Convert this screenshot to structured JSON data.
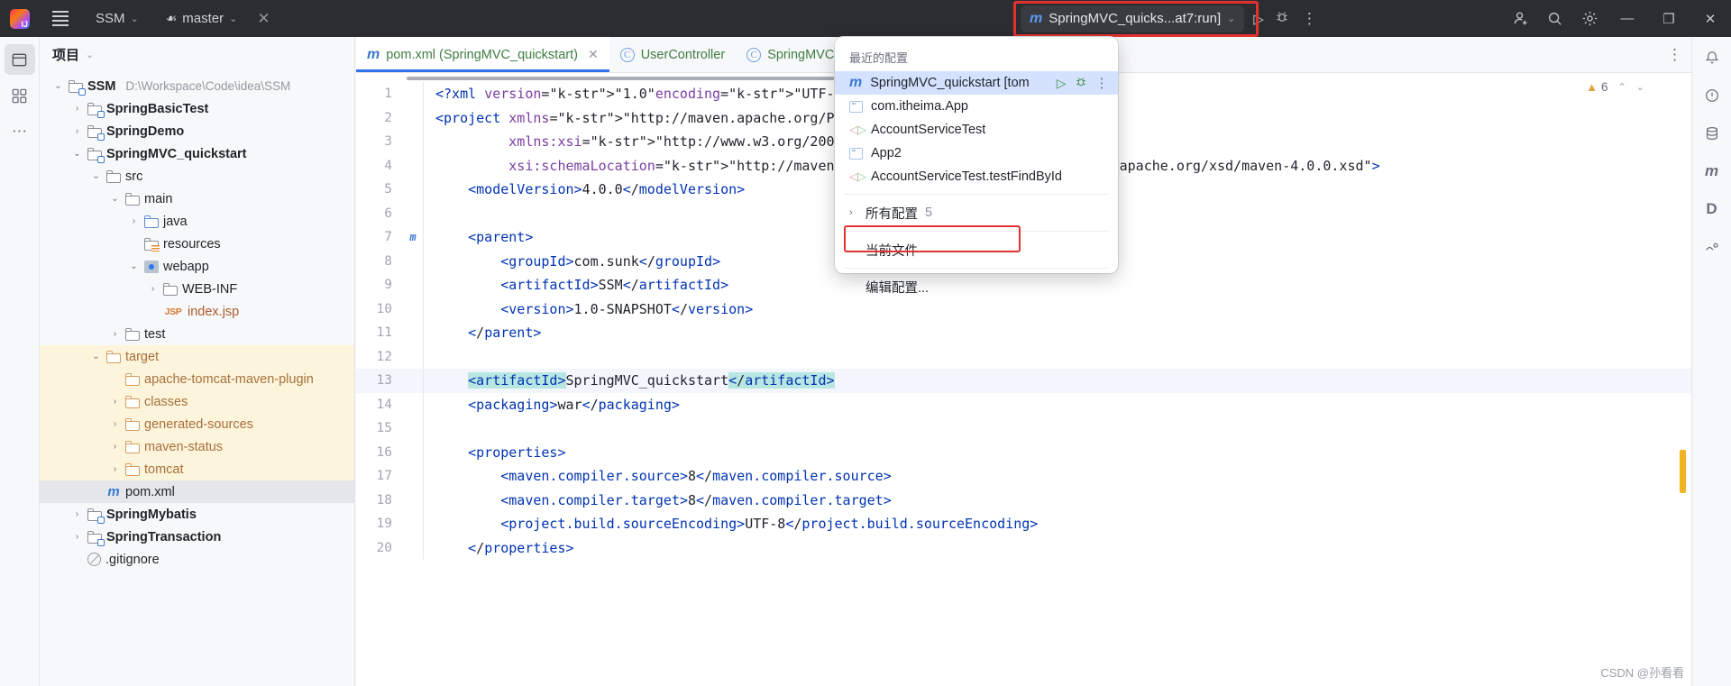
{
  "titlebar": {
    "app_logo": "intellij-idea-logo",
    "project_name": "SSM",
    "branch_icon": "git-branch-icon",
    "branch_name": "master",
    "close_label": "✕",
    "chevron": "⌄",
    "run_config": {
      "icon": "maven-m-icon",
      "label": "SpringMVC_quicks...at7:run]",
      "chevron": "⌄"
    },
    "run_button": "▷",
    "debug_button": "debug-icon",
    "more_button": "⋮",
    "account_button": "add-account-icon",
    "search_button": "search-icon",
    "settings_button": "settings-gear-icon",
    "minimize": "—",
    "maximize": "❐",
    "close_window": "✕"
  },
  "left_rail": {
    "items": [
      {
        "name": "project-tool-window",
        "glyph": "▢",
        "active": true
      },
      {
        "name": "structure-tool-window",
        "glyph": "⊞",
        "active": false
      },
      {
        "name": "more-tool-windows",
        "glyph": "⋯",
        "active": false
      }
    ]
  },
  "right_rail": {
    "items": [
      {
        "name": "notifications-icon",
        "glyph": "⚑"
      },
      {
        "name": "problems-icon",
        "glyph": "ⓘ"
      },
      {
        "name": "database-icon",
        "glyph": "⛁"
      },
      {
        "name": "maven-icon",
        "glyph": "m"
      },
      {
        "name": "dependencies-icon",
        "glyph": "D"
      },
      {
        "name": "learn-icon",
        "glyph": "◔"
      }
    ]
  },
  "project_panel": {
    "title": "项目",
    "chevron": "⌄",
    "tree": [
      {
        "indent": 0,
        "arrow": "⌄",
        "icon": "module-folder",
        "label": "SSM",
        "bold": true,
        "path": "D:\\Workspace\\Code\\idea\\SSM",
        "state": "normal"
      },
      {
        "indent": 1,
        "arrow": "›",
        "icon": "module-folder",
        "label": "SpringBasicTest",
        "bold": true,
        "state": "normal"
      },
      {
        "indent": 1,
        "arrow": "›",
        "icon": "module-folder",
        "label": "SpringDemo",
        "bold": true,
        "state": "normal"
      },
      {
        "indent": 1,
        "arrow": "⌄",
        "icon": "module-folder",
        "label": "SpringMVC_quickstart",
        "bold": true,
        "state": "normal"
      },
      {
        "indent": 2,
        "arrow": "⌄",
        "icon": "folder",
        "label": "src",
        "state": "normal"
      },
      {
        "indent": 3,
        "arrow": "⌄",
        "icon": "folder",
        "label": "main",
        "state": "normal"
      },
      {
        "indent": 4,
        "arrow": "›",
        "icon": "source-folder",
        "label": "java",
        "state": "normal"
      },
      {
        "indent": 4,
        "arrow": "",
        "icon": "resources-folder",
        "label": "resources",
        "state": "normal"
      },
      {
        "indent": 4,
        "arrow": "⌄",
        "icon": "webapp-folder",
        "label": "webapp",
        "state": "normal"
      },
      {
        "indent": 5,
        "arrow": "›",
        "icon": "folder",
        "label": "WEB-INF",
        "state": "normal"
      },
      {
        "indent": 5,
        "arrow": "",
        "icon": "jsp-file",
        "label": "index.jsp",
        "state": "normal"
      },
      {
        "indent": 3,
        "arrow": "›",
        "icon": "folder",
        "label": "test",
        "state": "normal"
      },
      {
        "indent": 2,
        "arrow": "⌄",
        "icon": "target-folder",
        "label": "target",
        "state": "target"
      },
      {
        "indent": 3,
        "arrow": "",
        "icon": "target-folder",
        "label": "apache-tomcat-maven-plugin",
        "state": "target"
      },
      {
        "indent": 3,
        "arrow": "›",
        "icon": "target-folder",
        "label": "classes",
        "state": "target"
      },
      {
        "indent": 3,
        "arrow": "›",
        "icon": "target-folder",
        "label": "generated-sources",
        "state": "target"
      },
      {
        "indent": 3,
        "arrow": "›",
        "icon": "target-folder",
        "label": "maven-status",
        "state": "target"
      },
      {
        "indent": 3,
        "arrow": "›",
        "icon": "target-folder",
        "label": "tomcat",
        "state": "target"
      },
      {
        "indent": 2,
        "arrow": "",
        "icon": "maven-file",
        "label": "pom.xml",
        "state": "selected"
      },
      {
        "indent": 1,
        "arrow": "›",
        "icon": "module-folder",
        "label": "SpringMybatis",
        "bold": true,
        "state": "normal"
      },
      {
        "indent": 1,
        "arrow": "›",
        "icon": "module-folder",
        "label": "SpringTransaction",
        "bold": true,
        "state": "normal"
      },
      {
        "indent": 1,
        "arrow": "",
        "icon": "gitignore-file",
        "label": ".gitignore",
        "state": "normal"
      }
    ]
  },
  "editor": {
    "tabs": [
      {
        "icon": "maven-m-icon",
        "label": "pom.xml (SpringMVC_quickstart)",
        "active": true,
        "closable": true,
        "close": "✕"
      },
      {
        "icon": "class-c-icon",
        "label": "UserController",
        "active": false
      },
      {
        "icon": "class-c-icon",
        "label": "SpringMVCConfig",
        "active": false
      }
    ],
    "tab_options": "⋮",
    "warnings": {
      "icon": "warning-triangle-icon",
      "count": "6",
      "up": "⌃",
      "down": "⌄"
    },
    "lines": [
      {
        "num": "1",
        "gutter": "",
        "text": "<?xml version=\"1.0\" encoding=\"UTF-8\"?>"
      },
      {
        "num": "2",
        "gutter": "",
        "text": "<project xmlns=\"http://maven.apache.org/POM/4.0.0\""
      },
      {
        "num": "3",
        "gutter": "",
        "text": "         xmlns:xsi=\"http://www.w3.org/2001/XMLSchema-instance\""
      },
      {
        "num": "4",
        "gutter": "",
        "text": "         xsi:schemaLocation=\"http://maven.apache.org/POM/4.0.0 http://maven.apache.org/xsd/maven-4.0.0.xsd\">"
      },
      {
        "num": "5",
        "gutter": "",
        "text": "    <modelVersion>4.0.0</modelVersion>"
      },
      {
        "num": "6",
        "gutter": "",
        "text": ""
      },
      {
        "num": "7",
        "gutter": "m",
        "text": "    <parent>"
      },
      {
        "num": "8",
        "gutter": "",
        "text": "        <groupId>com.sunk</groupId>"
      },
      {
        "num": "9",
        "gutter": "",
        "text": "        <artifactId>SSM</artifactId>"
      },
      {
        "num": "10",
        "gutter": "",
        "text": "        <version>1.0-SNAPSHOT</version>"
      },
      {
        "num": "11",
        "gutter": "",
        "text": "    </parent>"
      },
      {
        "num": "12",
        "gutter": "",
        "text": ""
      },
      {
        "num": "13",
        "gutter": "",
        "text": "    <artifactId>SpringMVC_quickstart</artifactId>",
        "current": true,
        "highlight": true
      },
      {
        "num": "14",
        "gutter": "",
        "text": "    <packaging>war</packaging>"
      },
      {
        "num": "15",
        "gutter": "",
        "text": ""
      },
      {
        "num": "16",
        "gutter": "",
        "text": "    <properties>"
      },
      {
        "num": "17",
        "gutter": "",
        "text": "        <maven.compiler.source>8</maven.compiler.source>"
      },
      {
        "num": "18",
        "gutter": "",
        "text": "        <maven.compiler.target>8</maven.compiler.target>"
      },
      {
        "num": "19",
        "gutter": "",
        "text": "        <project.build.sourceEncoding>UTF-8</project.build.sourceEncoding>"
      },
      {
        "num": "20",
        "gutter": "",
        "text": "    </properties>"
      }
    ]
  },
  "run_popup": {
    "section_recent": "最近的配置",
    "items": [
      {
        "icon": "maven-m-icon",
        "label": "SpringMVC_quickstart [tom",
        "selected": true,
        "run": "▷",
        "debug": "debug-icon",
        "more": "⋮"
      },
      {
        "icon": "app-square-icon",
        "label": "com.itheima.App",
        "selected": false
      },
      {
        "icon": "test-arrows-icon",
        "label": "AccountServiceTest",
        "selected": false
      },
      {
        "icon": "app-square-icon",
        "label": "App2",
        "selected": false
      },
      {
        "icon": "test-arrows-icon",
        "label": "AccountServiceTest.testFindById",
        "selected": false
      }
    ],
    "all_configs": {
      "chevron": "›",
      "label": "所有配置",
      "count": "5"
    },
    "current_file": "当前文件",
    "edit_configs": "编辑配置..."
  },
  "watermark": "CSDN @孙看看",
  "colors": {
    "accent_blue": "#3574f0",
    "titlebar_bg": "#2b2d30",
    "panel_bg": "#f7f8fa",
    "target_hl": "#fdf4dc",
    "red_annotation": "#e33131",
    "selection_blue": "#d4e2ff",
    "code_highlight": "#b8e6e2"
  }
}
